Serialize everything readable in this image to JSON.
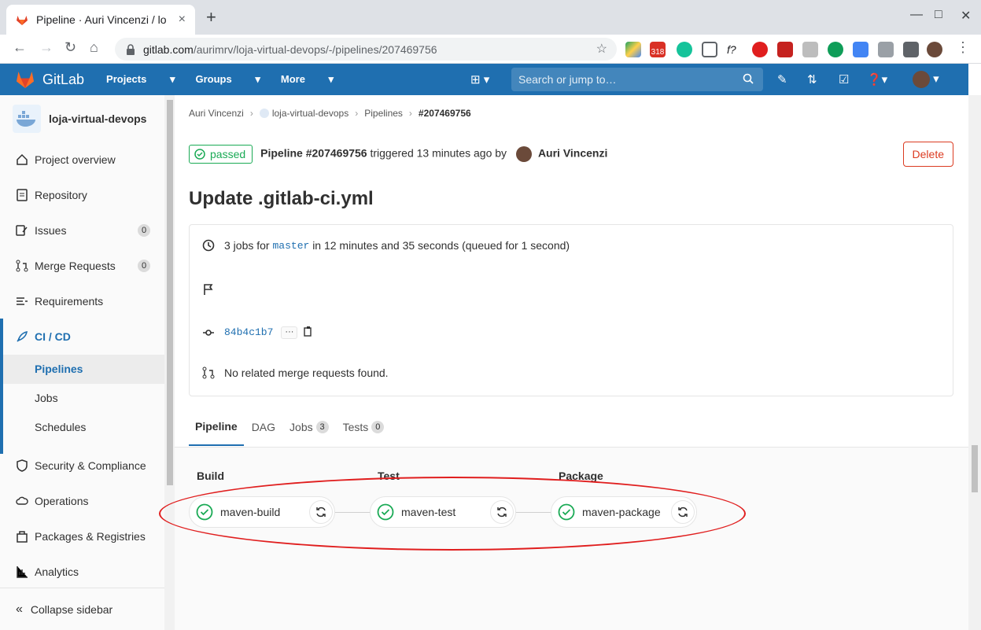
{
  "browser": {
    "tab_title": "Pipeline · Auri Vincenzi / lo",
    "tab_close": "×",
    "new_tab": "+",
    "url_host": "gitlab.com",
    "url_path": "/aurimrv/loja-virtual-devops/-/pipelines/207469756",
    "ext_badge": "318"
  },
  "topnav": {
    "brand": "GitLab",
    "menu": [
      "Projects",
      "Groups",
      "More"
    ],
    "search_placeholder": "Search or jump to…"
  },
  "sidebar": {
    "project_name": "loja-virtual-devops",
    "items": [
      {
        "label": "Project overview"
      },
      {
        "label": "Repository"
      },
      {
        "label": "Issues",
        "badge": "0"
      },
      {
        "label": "Merge Requests",
        "badge": "0"
      },
      {
        "label": "Requirements"
      },
      {
        "label": "CI / CD"
      }
    ],
    "cicd_sub": [
      "Pipelines",
      "Jobs",
      "Schedules"
    ],
    "items_after": [
      {
        "label": "Security & Compliance"
      },
      {
        "label": "Operations"
      },
      {
        "label": "Packages & Registries"
      },
      {
        "label": "Analytics"
      }
    ],
    "collapse": "Collapse sidebar"
  },
  "breadcrumb": [
    "Auri Vincenzi",
    "loja-virtual-devops",
    "Pipelines",
    "#207469756"
  ],
  "pipeline": {
    "status": "passed",
    "label": "Pipeline #207469756",
    "triggered": "triggered 13 minutes ago by",
    "author": "Auri Vincenzi",
    "delete": "Delete",
    "commit_title": "Update .gitlab-ci.yml",
    "jobs_prefix": "3 jobs for",
    "branch": "master",
    "jobs_suffix": "in 12 minutes and 35 seconds (queued for 1 second)",
    "sha": "84b4c1b7",
    "sha_more": "···",
    "no_mr": "No related merge requests found."
  },
  "tabs": [
    {
      "label": "Pipeline"
    },
    {
      "label": "DAG"
    },
    {
      "label": "Jobs",
      "count": "3"
    },
    {
      "label": "Tests",
      "count": "0"
    }
  ],
  "stages": [
    {
      "name": "Build",
      "job": "maven-build"
    },
    {
      "name": "Test",
      "job": "maven-test"
    },
    {
      "name": "Package",
      "job": "maven-package"
    }
  ],
  "colors": {
    "success": "#1aaa55",
    "brand": "#1f6fb0",
    "danger": "#db3b21",
    "annotation": "#e01e1e"
  }
}
